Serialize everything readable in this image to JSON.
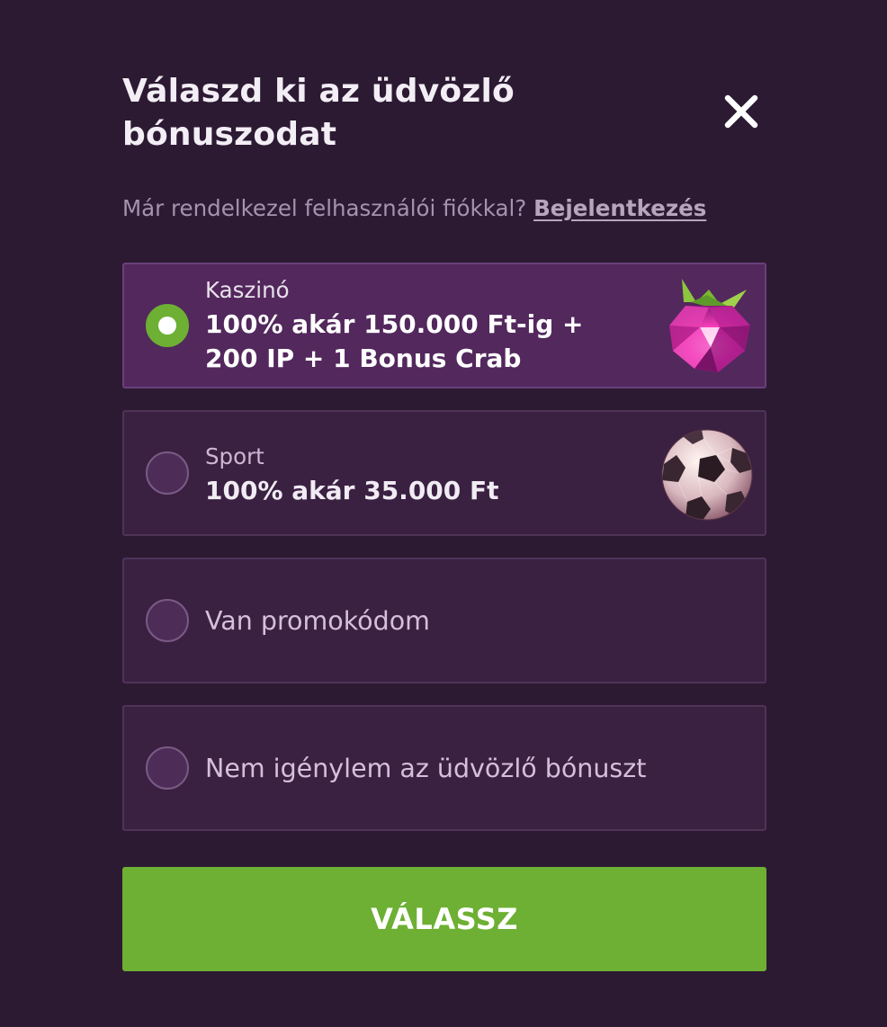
{
  "modal": {
    "title": "Válaszd ki az üdvözlő bónuszodat",
    "close_icon": "close-icon",
    "account_prompt": "Már rendelkezel felhasználói fiókkal?",
    "login_link": "Bejelentkezés"
  },
  "options": [
    {
      "category": "Kaszinó",
      "amount_line1": "100% akár 150.000 Ft-ig +",
      "amount_line2": "200 IP + 1 Bonus Crab",
      "selected": true,
      "icon": "raspberry-gem-icon"
    },
    {
      "category": "Sport",
      "amount_line1": "100% akár 35.000 Ft",
      "selected": false,
      "icon": "soccer-ball-icon"
    },
    {
      "label": "Van promokódom",
      "selected": false
    },
    {
      "label": "Nem igénylem az üdvözlő bónuszt",
      "selected": false
    }
  ],
  "submit_label": "VÁLASSZ",
  "colors": {
    "background": "#2c1a33",
    "option_bg": "#3a2142",
    "option_selected_bg": "#53285d",
    "accent_green": "#6db033"
  }
}
